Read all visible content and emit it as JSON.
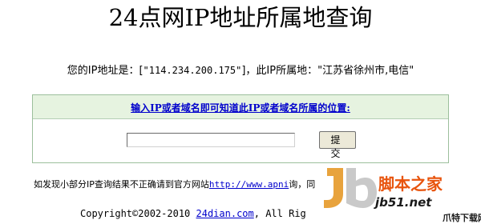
{
  "page": {
    "title": "24点网IP地址所属地查询"
  },
  "ip_info": {
    "prefix": "您的IP地址是：[",
    "ip": "\"114.234.200.175\"",
    "middle": "]，此IP所属地：",
    "location": "\"江苏省徐州市,电信\""
  },
  "query": {
    "header_link": "输入IP或者域名即可知道此IP或者域名所属的位置:",
    "input_value": "",
    "submit_label": "提 交"
  },
  "notice": {
    "text": "如发现小部分IP查询结果不正确请到官方网站",
    "link": "http://www.apni",
    "suffix": "询，同"
  },
  "footer": {
    "copyright": "Copyright©2002-2010 ",
    "site_link": "24dian.com",
    "rights": ", All Rig"
  },
  "watermark": {
    "text": "脚本之家",
    "domain": "jb51.net",
    "brand": "爪特下载网"
  }
}
